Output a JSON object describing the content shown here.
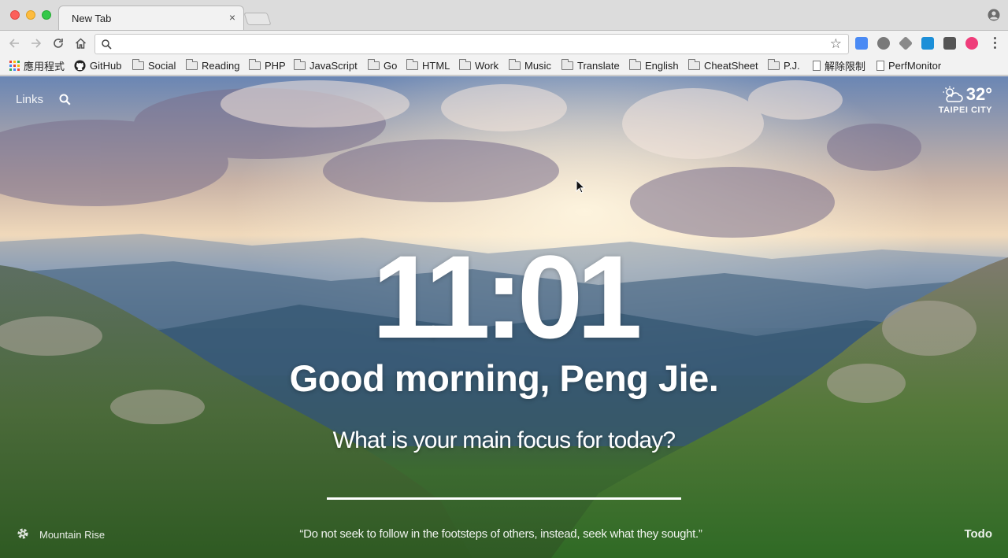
{
  "browser": {
    "tab_title": "New Tab",
    "tab_close": "×",
    "address_value": "",
    "bookmark_star": "☆",
    "bookmarks": [
      {
        "label": "應用程式",
        "icon": "apps-grid-icon"
      },
      {
        "label": "GitHub",
        "icon": "github-icon"
      },
      {
        "label": "Social",
        "icon": "folder-icon"
      },
      {
        "label": "Reading",
        "icon": "folder-icon"
      },
      {
        "label": "PHP",
        "icon": "folder-icon"
      },
      {
        "label": "JavaScript",
        "icon": "folder-icon"
      },
      {
        "label": "Go",
        "icon": "folder-icon"
      },
      {
        "label": "HTML",
        "icon": "folder-icon"
      },
      {
        "label": "Work",
        "icon": "folder-icon"
      },
      {
        "label": "Music",
        "icon": "folder-icon"
      },
      {
        "label": "Translate",
        "icon": "folder-icon"
      },
      {
        "label": "English",
        "icon": "folder-icon"
      },
      {
        "label": "CheatSheet",
        "icon": "folder-icon"
      },
      {
        "label": "P.J.",
        "icon": "folder-icon"
      },
      {
        "label": "解除限制",
        "icon": "page-icon"
      },
      {
        "label": "PerfMonitor",
        "icon": "page-icon"
      }
    ],
    "extensions": [
      {
        "name": "google-translate-icon",
        "color": "#4a8af4"
      },
      {
        "name": "ublock-icon",
        "color": "#7a7a7a"
      },
      {
        "name": "layers-icon",
        "color": "#8a8a8a"
      },
      {
        "name": "s-extension-icon",
        "color": "#1c8fd8"
      },
      {
        "name": "grid-extension-icon",
        "color": "#555555"
      },
      {
        "name": "pink-extension-icon",
        "color": "#ef3d7a"
      }
    ]
  },
  "page": {
    "links_label": "Links",
    "weather": {
      "temp": "32°",
      "location": "TAIPEI CITY",
      "icon": "partly-cloudy-icon"
    },
    "clock": "11:01",
    "greeting": "Good morning, Peng Jie.",
    "focus_question": "What is your main focus for today?",
    "focus_value": "",
    "photo_credit": "Mountain Rise",
    "quote": "“Do not seek to follow in the footsteps of others, instead, seek what they sought.”",
    "todo_label": "Todo"
  }
}
